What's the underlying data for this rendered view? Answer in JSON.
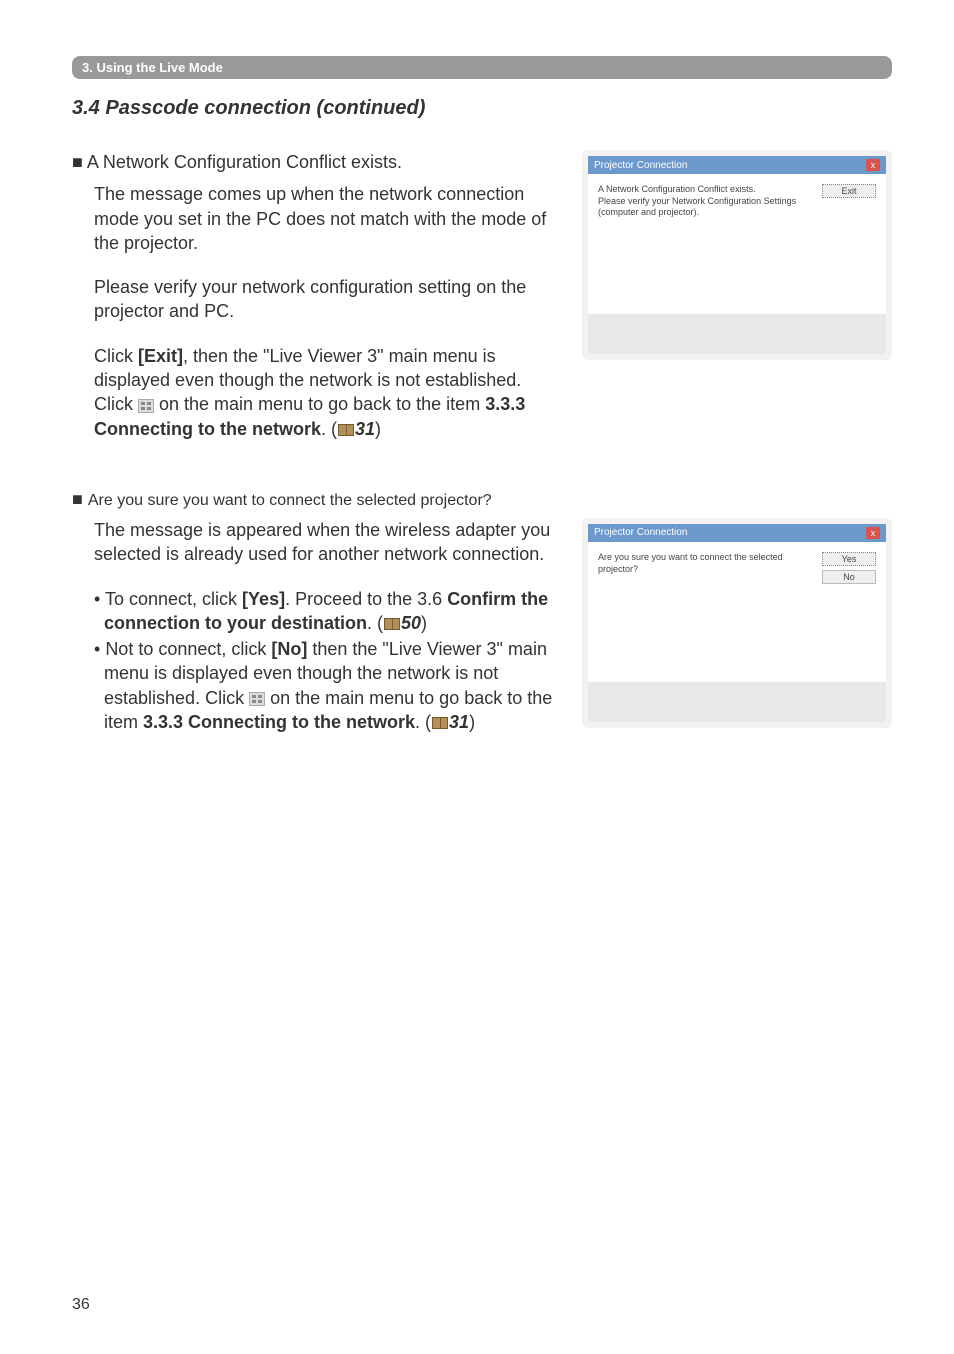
{
  "section_bar": "3. Using the Live Mode",
  "heading": "3.4 Passcode connection (continued)",
  "block1": {
    "bullet": "A Network Configuration Conflict exists.",
    "p1": "The message comes up when the network connection mode you set in the PC does not match with the mode of the projector.",
    "p2": "Please verify your network configuration setting on the projector and PC.",
    "p3a": "Click ",
    "p3_exit": "[Exit]",
    "p3b": ", then the \"Live Viewer 3\" main menu is displayed even though the network is not established. Click ",
    "p3c": " on the main menu to go back to the item ",
    "p3_ref": "3.3.3 Connecting to the network",
    "p3d": ". (",
    "p3_page": "31",
    "p3e": ")"
  },
  "block2": {
    "bullet": "Are you sure you want to connect the selected projector?",
    "p1": "The message is appeared when the wireless adapter you selected is already used for another network connection.",
    "li1a": "To connect, click ",
    "li1_yes": "[Yes]",
    "li1b": ". Proceed to the 3.6 ",
    "li1_ref": "Confirm the connection to your destination",
    "li1c": ". (",
    "li1_page": "50",
    "li1d": ")",
    "li2a": "Not to connect, click ",
    "li2_no": "[No]",
    "li2b": " then the \"Live Viewer 3\" main menu is displayed even though the network is not established. Click ",
    "li2c": " on the main menu to go back to the item ",
    "li2_ref": "3.3.3 Connecting to the network",
    "li2d": ". (",
    "li2_page": "31",
    "li2e": ")"
  },
  "dialog1": {
    "title": "Projector Connection",
    "msg1": "A Network Configuration Conflict exists.",
    "msg2": "Please verify your Network Configuration Settings (computer and projector).",
    "exit_btn": "Exit"
  },
  "dialog2": {
    "title": "Projector Connection",
    "msg": "Are you sure you want to connect the selected projector?",
    "yes_btn": "Yes",
    "no_btn": "No"
  },
  "page_number": "36"
}
